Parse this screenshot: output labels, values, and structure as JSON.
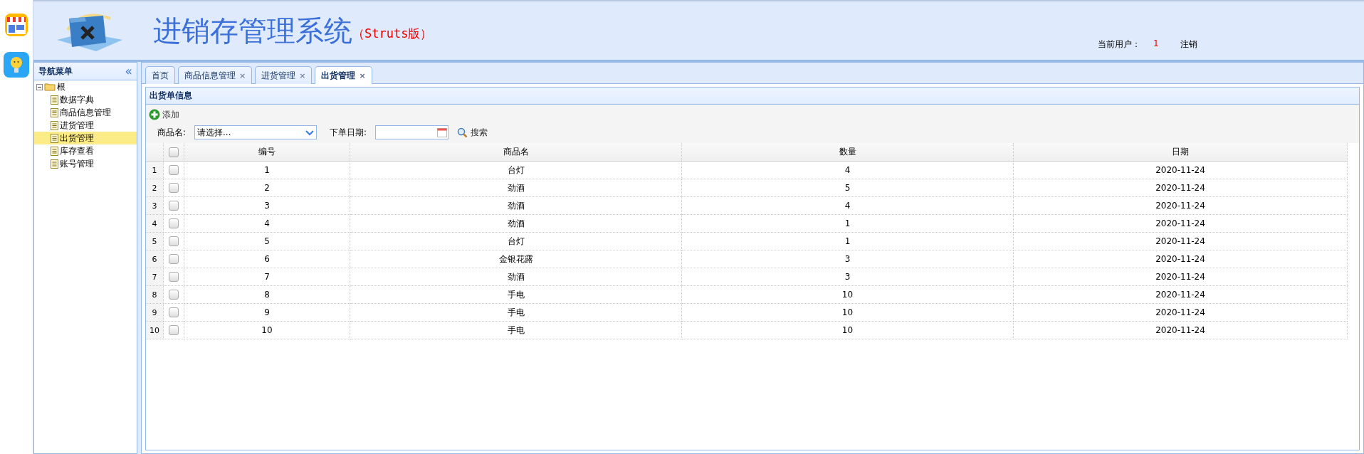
{
  "header": {
    "title": "进销存管理系统",
    "edition": "（Struts版）",
    "user_label": "当前用户：",
    "user_name": "1",
    "logout": "注销"
  },
  "sidebar": {
    "title": "导航菜单",
    "collapse": "«",
    "tree": [
      {
        "label": "根",
        "expanded": true,
        "selected": false,
        "children": [
          {
            "label": "数据字典",
            "selected": false
          },
          {
            "label": "商品信息管理",
            "selected": false
          },
          {
            "label": "进货管理",
            "selected": false
          },
          {
            "label": "出货管理",
            "selected": true
          },
          {
            "label": "库存查看",
            "selected": false
          },
          {
            "label": "账号管理",
            "selected": false
          }
        ]
      }
    ]
  },
  "tabs": [
    {
      "label": "首页",
      "selected": false
    },
    {
      "label": "商品信息管理",
      "selected": false,
      "close": "×"
    },
    {
      "label": "进货管理",
      "selected": false,
      "close": "×"
    },
    {
      "label": "出货管理",
      "selected": true,
      "close": "×"
    }
  ],
  "panel": {
    "title": "出货单信息",
    "add_button": "添加",
    "filters": {
      "product_label": "商品名:",
      "product_placeholder": "请选择...",
      "date_label": "下单日期:",
      "search_button": "搜索"
    }
  },
  "table": {
    "columns": [
      "编号",
      "商品名",
      "数量",
      "日期"
    ],
    "all_checked": false,
    "rows": [
      {
        "index": "1",
        "checked": false,
        "cells": [
          "1",
          "台灯",
          "4",
          "2020-11-24"
        ]
      },
      {
        "index": "2",
        "checked": false,
        "cells": [
          "2",
          "劲酒",
          "5",
          "2020-11-24"
        ]
      },
      {
        "index": "3",
        "checked": false,
        "cells": [
          "3",
          "劲酒",
          "4",
          "2020-11-24"
        ]
      },
      {
        "index": "4",
        "checked": false,
        "cells": [
          "4",
          "劲酒",
          "1",
          "2020-11-24"
        ]
      },
      {
        "index": "5",
        "checked": false,
        "cells": [
          "5",
          "台灯",
          "1",
          "2020-11-24"
        ]
      },
      {
        "index": "6",
        "checked": false,
        "cells": [
          "6",
          "金银花露",
          "3",
          "2020-11-24"
        ]
      },
      {
        "index": "7",
        "checked": false,
        "cells": [
          "7",
          "劲酒",
          "3",
          "2020-11-24"
        ]
      },
      {
        "index": "8",
        "checked": false,
        "cells": [
          "8",
          "手电",
          "10",
          "2020-11-24"
        ]
      },
      {
        "index": "9",
        "checked": false,
        "cells": [
          "9",
          "手电",
          "10",
          "2020-11-24"
        ]
      },
      {
        "index": "10",
        "checked": false,
        "cells": [
          "10",
          "手电",
          "10",
          "2020-11-24"
        ]
      }
    ]
  }
}
